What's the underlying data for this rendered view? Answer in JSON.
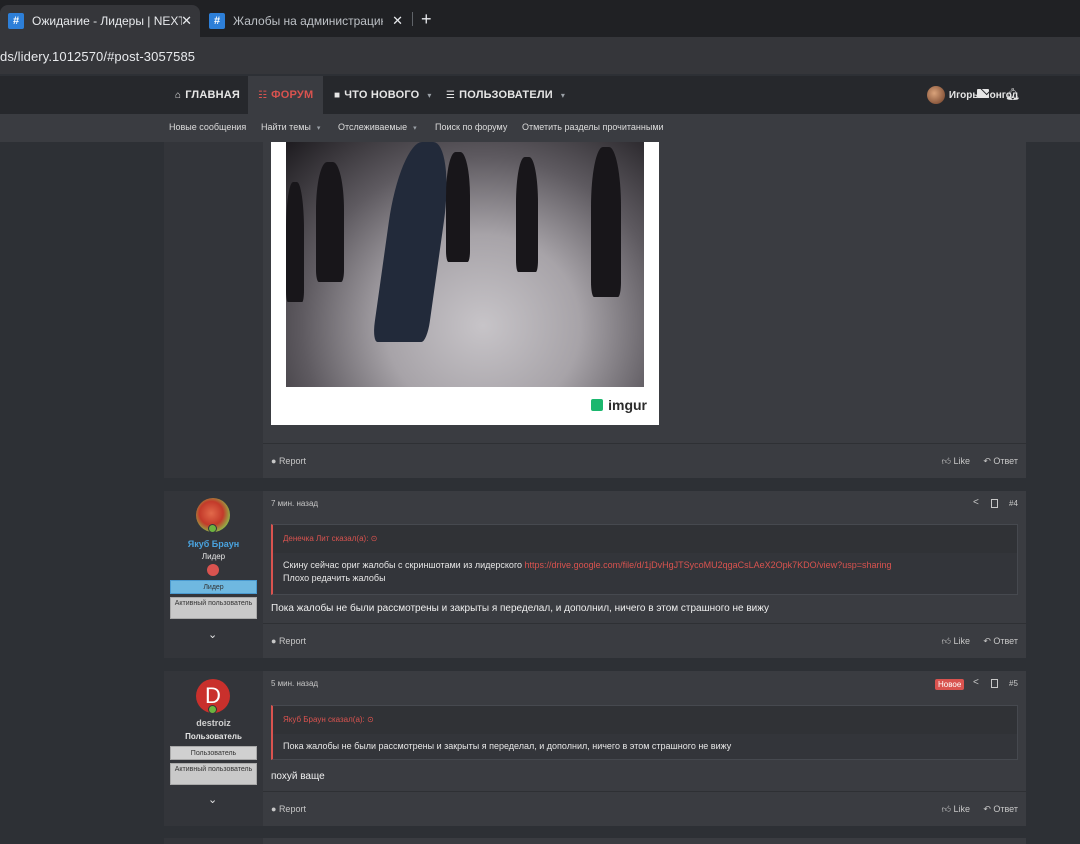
{
  "browser": {
    "tabs": [
      {
        "title": "Ожидание - Лидеры | NEXTRP",
        "favicon": "#",
        "active": true
      },
      {
        "title": "Жалобы на администрацию се",
        "favicon": "#",
        "active": false
      }
    ],
    "close_glyph": "✕",
    "new_tab_glyph": "+",
    "url": "ds/lidery.1012570/#post-3057585"
  },
  "nav": {
    "home": "Главная",
    "forum": "Форум",
    "whats_new": "Что нового",
    "users": "Пользователи",
    "username": "Игорь Монгол",
    "caret": "▾"
  },
  "subnav": {
    "new_posts": "Новые сообщения",
    "find_threads": "Найти темы",
    "watched": "Отслеживаемые",
    "search_forum": "Поиск по форуму",
    "mark_read": "Отметить разделы прочитанными"
  },
  "labels": {
    "report": "Report",
    "like": "Like",
    "reply": "Ответ",
    "new_badge": "Новое"
  },
  "image": {
    "caption_logo": "imgur"
  },
  "posts": [
    {
      "time": "7 мин. назад",
      "number": "#4",
      "author": "Якуб Браун",
      "author_title": "Лидер",
      "badge_primary": "Лидер",
      "badge_secondary": "Активный пользователь",
      "quote_author": "Денечка Лит сказал(а):",
      "quote_text_prefix": "Скину сейчас ориг жалобы с скриншотами из лидерского ",
      "quote_link": "https://drive.google.com/file/d/1jDvHgJTSycoMU2qgaCsLAeX2Opk7KDO/view?usp=sharing",
      "quote_text_line2": "Плохо редачить жалобы",
      "message": "Пока жалобы не были рассмотрены и закрыты я переделал, и дополнил, ничего в этом страшного не вижу"
    },
    {
      "time": "5 мин. назад",
      "number": "#5",
      "author": "destroiz",
      "author_initial": "D",
      "author_title": "Пользователь",
      "badge_primary": "Пользователь",
      "badge_secondary": "Активный пользователь",
      "quote_author": "Якуб Браун сказал(а):",
      "quote_text": "Пока жалобы не были рассмотрены и закрыты я переделал, и дополнил, ничего в этом страшного не вижу",
      "message": "похуй ваще"
    }
  ],
  "colors": {
    "accent": "#d9534f",
    "leader_name": "#4aa3df",
    "leader_badge": "#6fb8e0",
    "user_name": "#cfcfcf",
    "online": "#6db33f"
  }
}
